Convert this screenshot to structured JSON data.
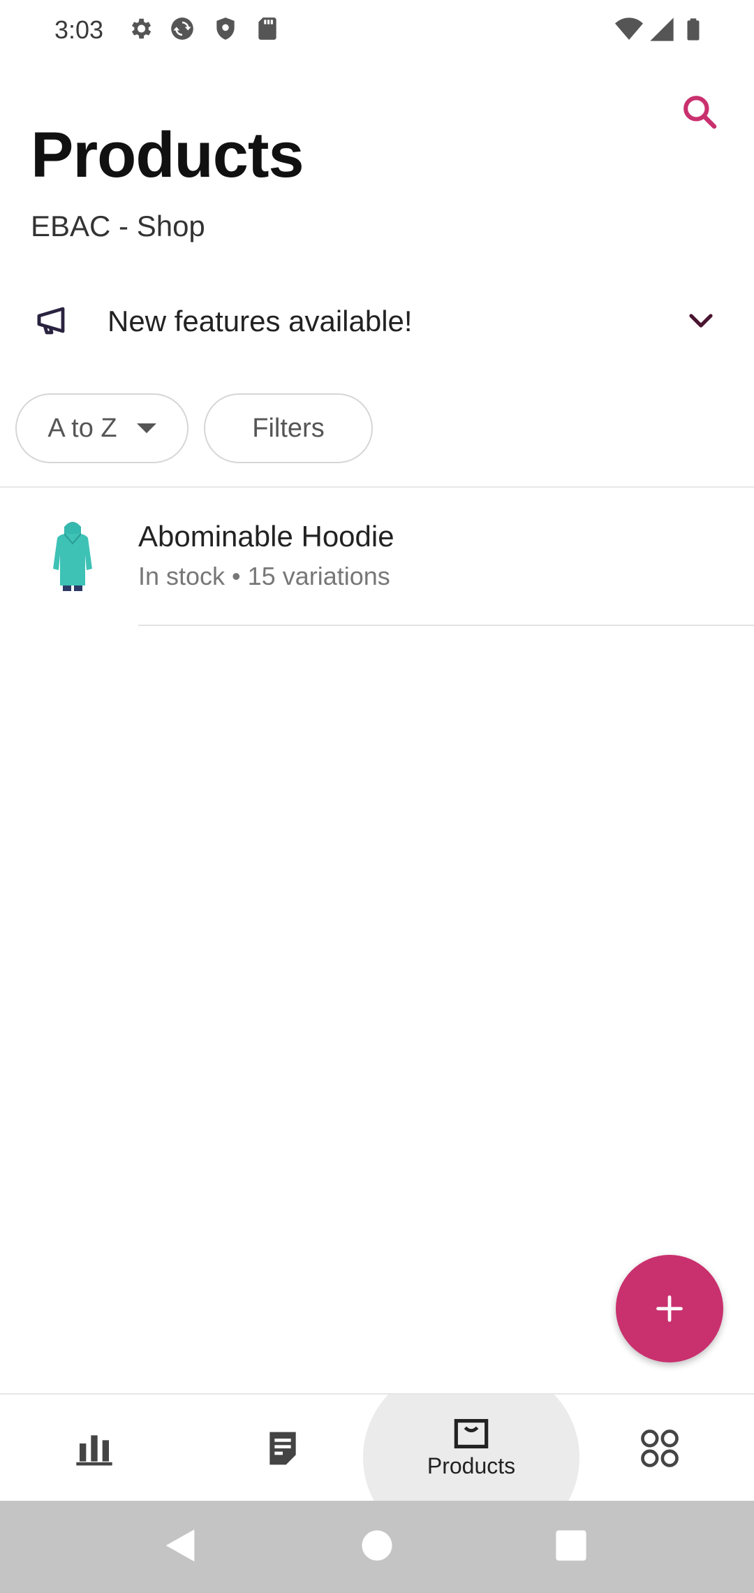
{
  "status_bar": {
    "time": "3:03",
    "icons_left": [
      "gear-icon",
      "sync-icon",
      "shield-icon",
      "sd-card-icon"
    ],
    "icons_right": [
      "wifi-icon",
      "cell-signal-icon",
      "battery-icon"
    ]
  },
  "header": {
    "title": "Products",
    "subtitle": "EBAC - Shop",
    "search_icon": "search-icon"
  },
  "announcement": {
    "icon": "megaphone-icon",
    "text": "New features available!",
    "expand_icon": "chevron-down-icon"
  },
  "filters": {
    "sort_label": "A to Z",
    "filters_label": "Filters"
  },
  "products": [
    {
      "name": "Abominable Hoodie",
      "meta": "In stock • 15 variations"
    }
  ],
  "fab": {
    "icon": "plus-icon"
  },
  "bottom_nav": {
    "items": [
      {
        "icon": "stats-icon",
        "label": ""
      },
      {
        "icon": "orders-icon",
        "label": ""
      },
      {
        "icon": "products-icon",
        "label": "Products",
        "active": true
      },
      {
        "icon": "more-icon",
        "label": ""
      }
    ]
  },
  "system_nav": [
    "back-icon",
    "home-icon",
    "recents-icon"
  ],
  "colors": {
    "accent": "#c9306e",
    "text_primary": "#111111",
    "text_secondary": "#777777",
    "chip_border": "#d6d6d6",
    "nav_highlight": "#ebebeb",
    "system_nav_bg": "#c4c4c4"
  }
}
